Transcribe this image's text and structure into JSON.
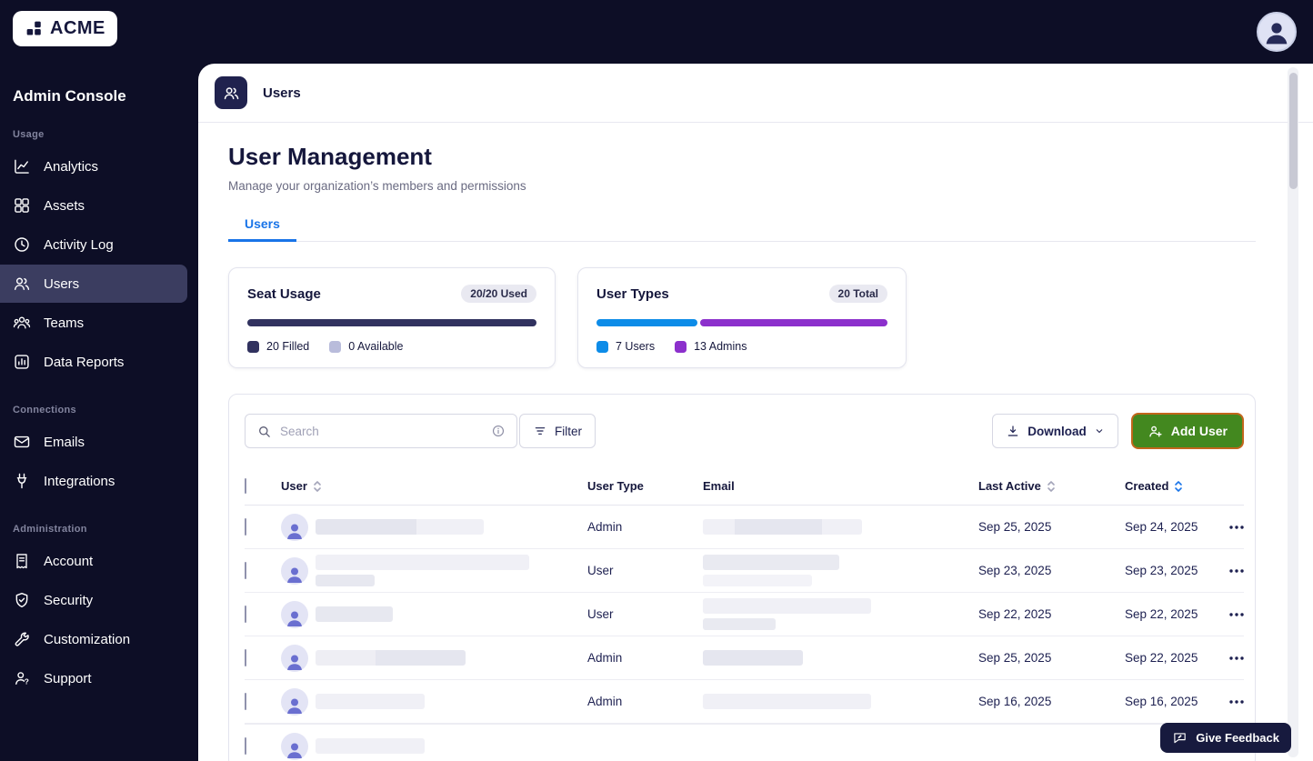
{
  "brand": {
    "logo_text": "ACME"
  },
  "sidebar": {
    "title": "Admin Console",
    "sections": [
      {
        "label": "Usage",
        "items": [
          {
            "label": "Analytics"
          },
          {
            "label": "Assets"
          },
          {
            "label": "Activity Log"
          },
          {
            "label": "Users",
            "active": true
          },
          {
            "label": "Teams"
          },
          {
            "label": "Data Reports"
          }
        ]
      },
      {
        "label": "Connections",
        "items": [
          {
            "label": "Emails"
          },
          {
            "label": "Integrations"
          }
        ]
      },
      {
        "label": "Administration",
        "items": [
          {
            "label": "Account"
          },
          {
            "label": "Security"
          },
          {
            "label": "Customization"
          },
          {
            "label": "Support"
          }
        ]
      }
    ]
  },
  "header": {
    "breadcrumb": "Users"
  },
  "page": {
    "title": "User Management",
    "subtitle": "Manage your organization’s members and permissions"
  },
  "tabs": [
    {
      "label": "Users",
      "active": true
    }
  ],
  "cards": {
    "seat_usage": {
      "title": "Seat Usage",
      "badge": "20/20 Used",
      "filled_pct": 100,
      "legend": [
        {
          "label": "20 Filled",
          "color": "#31325f"
        },
        {
          "label": "0 Available",
          "color": "#b9bcdb"
        }
      ]
    },
    "user_types": {
      "title": "User Types",
      "badge": "20 Total",
      "segments": [
        {
          "label": "7 Users",
          "color": "#0d8ce8",
          "pct": 35
        },
        {
          "label": "13 Admins",
          "color": "#8c30cc",
          "pct": 65
        }
      ]
    }
  },
  "toolbar": {
    "search_placeholder": "Search",
    "filter_label": "Filter",
    "download_label": "Download",
    "add_user_label": "Add User"
  },
  "table": {
    "columns": [
      "User",
      "User Type",
      "Email",
      "Last Active",
      "Created"
    ],
    "rows": [
      {
        "user_type": "Admin",
        "last_active": "Sep 25, 2025",
        "created": "Sep 24, 2025"
      },
      {
        "user_type": "User",
        "last_active": "Sep 23, 2025",
        "created": "Sep 23, 2025"
      },
      {
        "user_type": "User",
        "last_active": "Sep 22, 2025",
        "created": "Sep 22, 2025"
      },
      {
        "user_type": "Admin",
        "last_active": "Sep 25, 2025",
        "created": "Sep 22, 2025"
      },
      {
        "user_type": "Admin",
        "last_active": "Sep 16, 2025",
        "created": "Sep 16, 2025"
      }
    ]
  },
  "feedback": {
    "label": "Give Feedback"
  },
  "colors": {
    "accent_blue": "#1974e8",
    "chart_blue": "#0d8ce8",
    "chart_purple": "#8c30cc",
    "seat_navy": "#31325f",
    "add_green": "#43881f",
    "add_border_orange": "#c2661c",
    "sidebar_navy": "#0d0e26"
  }
}
